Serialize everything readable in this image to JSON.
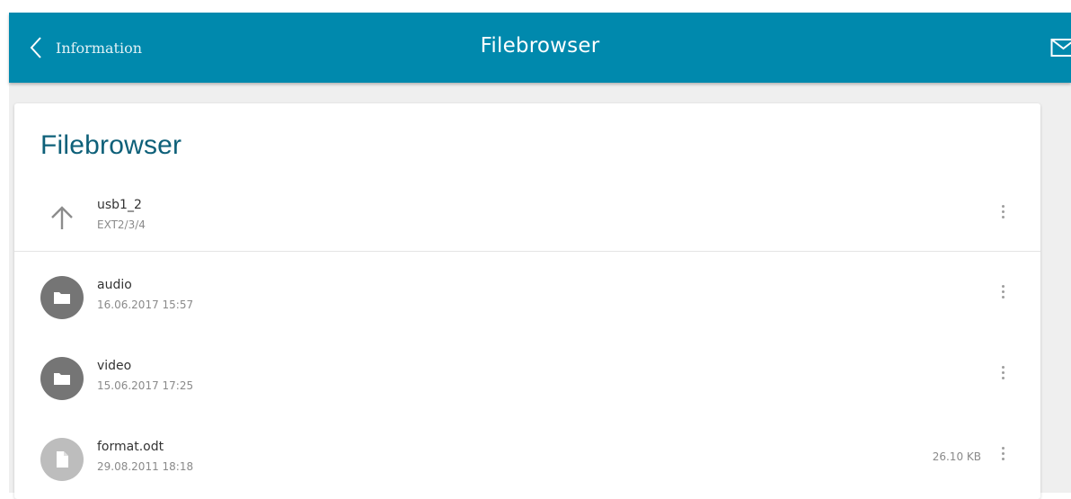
{
  "header": {
    "back_label": "Information",
    "title": "Filebrowser",
    "accent_color": "#0089ad"
  },
  "card": {
    "title": "Filebrowser",
    "parent": {
      "name": "usb1_2",
      "subtitle": "EXT2/3/4",
      "icon": "arrow-up-icon"
    },
    "items": [
      {
        "name": "audio",
        "date": "16.06.2017 15:57",
        "size": "",
        "icon": "folder-icon"
      },
      {
        "name": "video",
        "date": "15.06.2017 17:25",
        "size": "",
        "icon": "folder-icon"
      },
      {
        "name": "format.odt",
        "date": "29.08.2011 18:18",
        "size": "26.10 KB",
        "icon": "file-icon"
      }
    ]
  },
  "icons": {
    "back": "chevron-left-icon",
    "mail": "mail-icon",
    "menu": "more-vertical-icon"
  }
}
